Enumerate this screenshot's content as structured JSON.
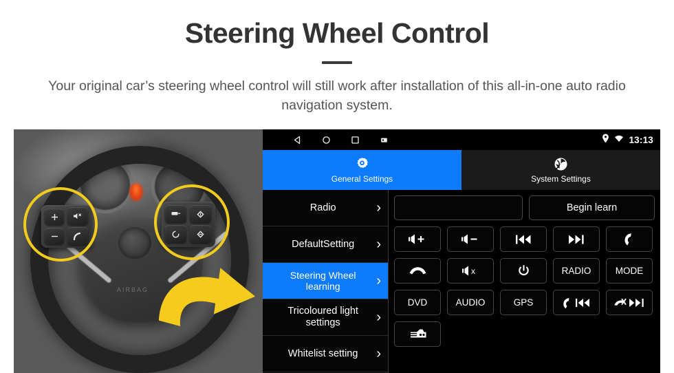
{
  "header": {
    "title": "Steering Wheel Control",
    "subtitle": "Your original car’s steering wheel control will still work after installation of this all-in-one auto radio navigation system."
  },
  "photo": {
    "alt_name": "steering-wheel-photo",
    "highlight_color": "#f2cb1f",
    "arrow_color": "#f5cb1e",
    "wheel_emblem_text": "AIRBAG",
    "left_cluster_buttons": [
      "+",
      "−",
      "mute-speaker",
      "phone-call"
    ],
    "right_cluster_buttons": [
      "mode",
      "diamond-up",
      "circle-arrow",
      "diamond-down"
    ]
  },
  "device": {
    "statusbar": {
      "nav_icons": [
        "back-icon",
        "home-icon",
        "recents-icon",
        "screenshot-icon"
      ],
      "location_icon": "location-pin-icon",
      "wifi_icon": "wifi-icon",
      "clock": "13:13"
    },
    "tabs": [
      {
        "label": "General Settings",
        "icon": "gear-icon",
        "active": true
      },
      {
        "label": "System Settings",
        "icon": "swirl-logo-icon",
        "active": false
      }
    ],
    "sidebar": [
      {
        "label": "Radio",
        "active": false
      },
      {
        "label": "DefaultSetting",
        "active": false
      },
      {
        "label": "Steering Wheel learning",
        "active": true
      },
      {
        "label": "Tricoloured light settings",
        "active": false
      },
      {
        "label": "Whitelist setting",
        "active": false
      }
    ],
    "chevron": "›",
    "panel": {
      "learn_display_value": "",
      "begin_learn_label": "Begin learn",
      "keys": [
        {
          "label": "",
          "icon": "volume-up-icon"
        },
        {
          "label": "",
          "icon": "volume-down-icon"
        },
        {
          "label": "",
          "icon": "previous-track-icon"
        },
        {
          "label": "",
          "icon": "next-track-icon"
        },
        {
          "label": "",
          "icon": "phone-answer-icon"
        },
        {
          "label": "",
          "icon": "phone-hangup-icon"
        },
        {
          "label": "",
          "icon": "mute-icon"
        },
        {
          "label": "",
          "icon": "power-icon"
        },
        {
          "label": "RADIO",
          "icon": ""
        },
        {
          "label": "MODE",
          "icon": ""
        },
        {
          "label": "DVD",
          "icon": ""
        },
        {
          "label": "AUDIO",
          "icon": ""
        },
        {
          "label": "GPS",
          "icon": ""
        },
        {
          "label": "",
          "icon": "phone-previous-icon"
        },
        {
          "label": "",
          "icon": "phone-hangup-next-icon"
        },
        {
          "label": "",
          "icon": "rear-camera-icon"
        }
      ]
    },
    "colors": {
      "accent_blue": "#0d7bfb",
      "panel_black": "#000000",
      "tab_dark": "#1b1b1b"
    }
  }
}
